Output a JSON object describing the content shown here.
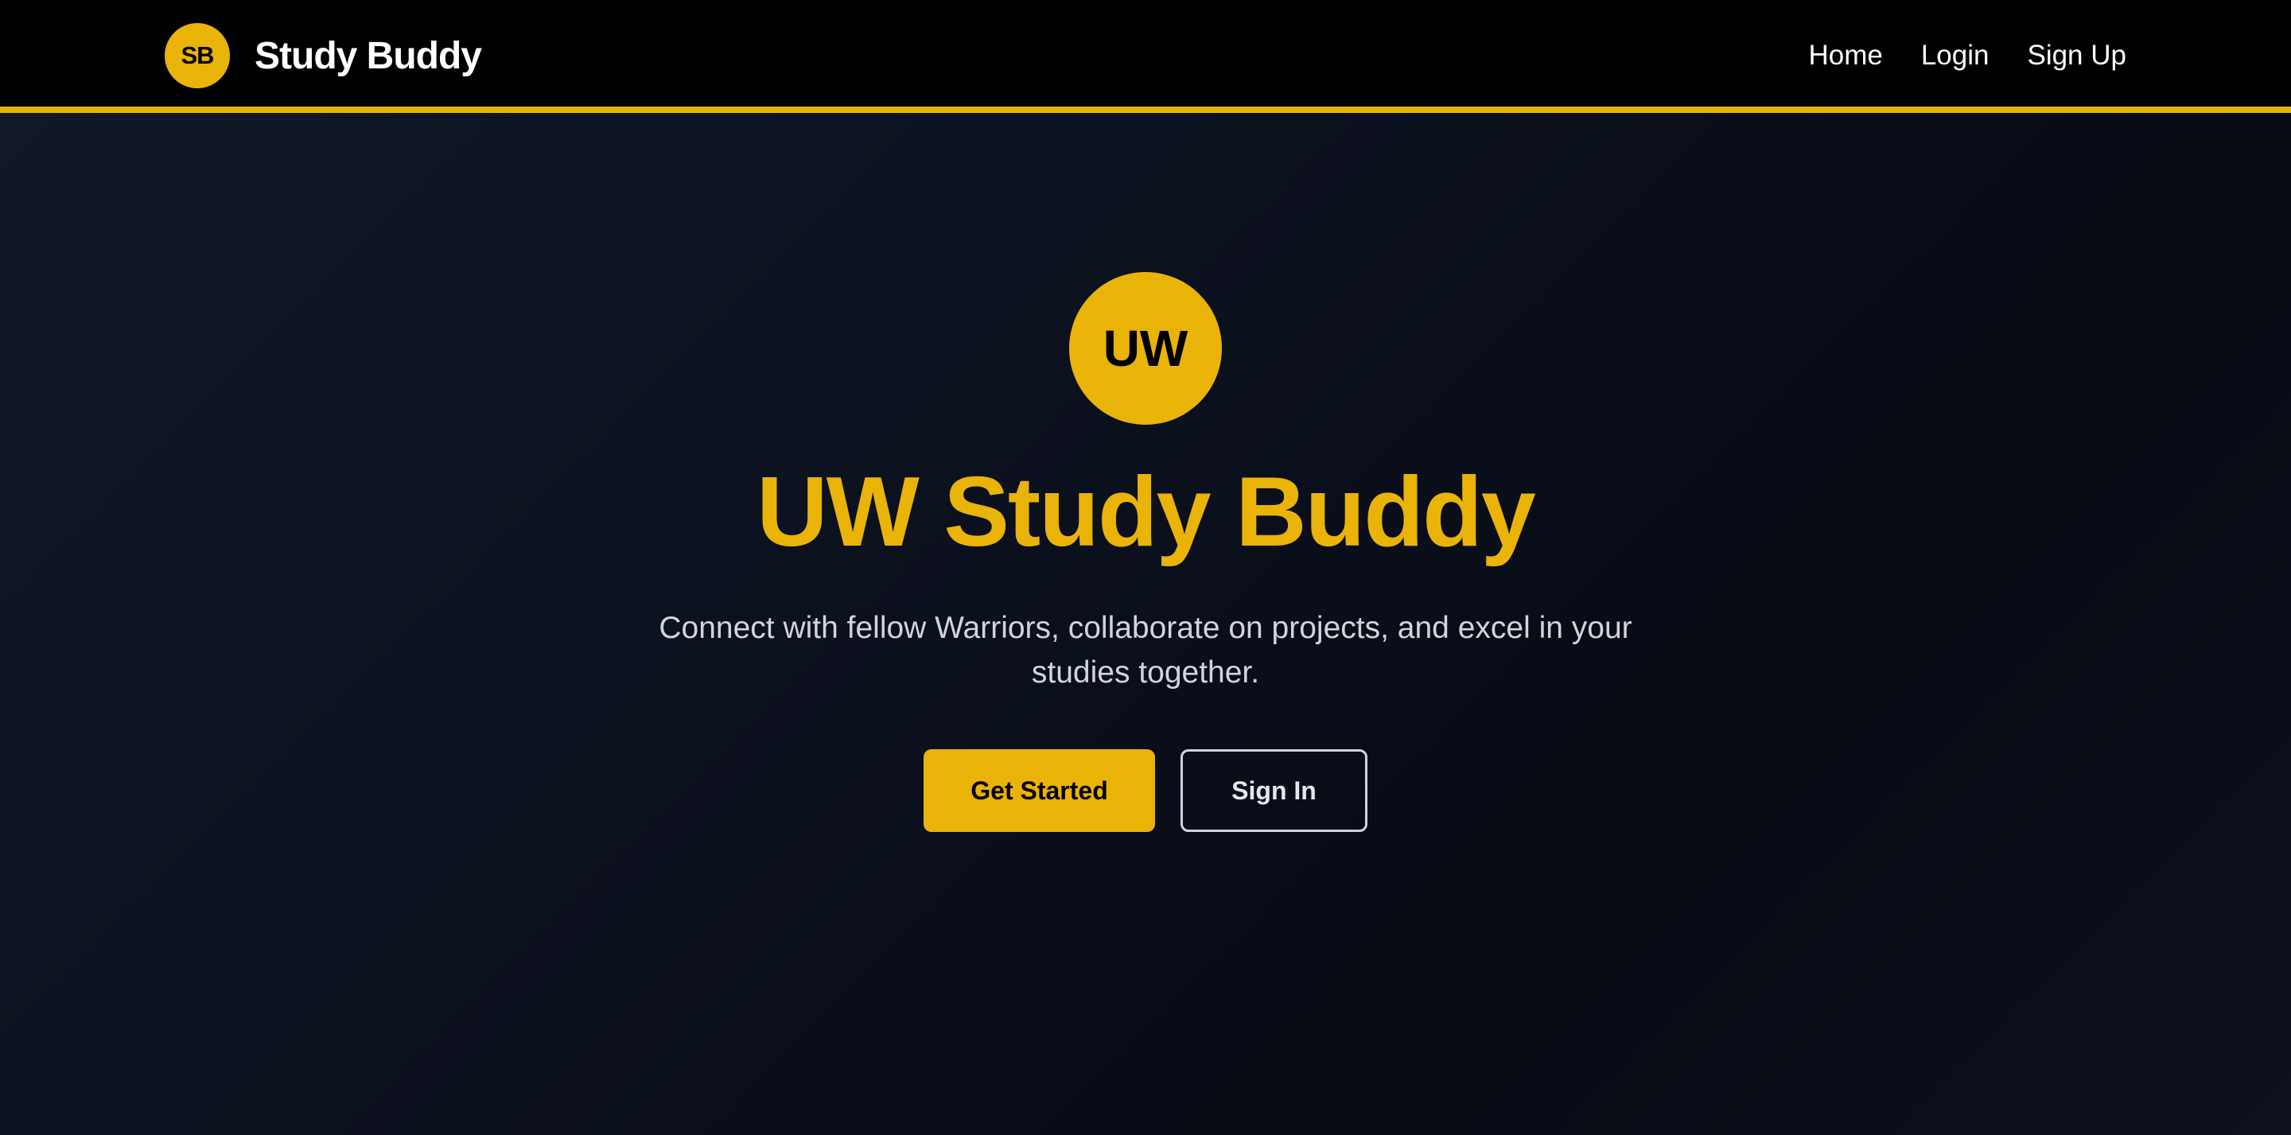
{
  "navbar": {
    "logo_text": "SB",
    "brand_name": "Study Buddy",
    "links": [
      {
        "label": "Home"
      },
      {
        "label": "Login"
      },
      {
        "label": "Sign Up"
      }
    ]
  },
  "hero": {
    "logo_text": "UW",
    "title": "UW Study Buddy",
    "subtitle": "Connect with fellow Warriors, collaborate on projects, and excel in your studies together.",
    "primary_button": "Get Started",
    "secondary_button": "Sign In"
  },
  "colors": {
    "accent": "#eab308",
    "navbar_bg": "#000000",
    "hero_bg": "#0b0f1a",
    "text_light": "#d1d5db"
  }
}
